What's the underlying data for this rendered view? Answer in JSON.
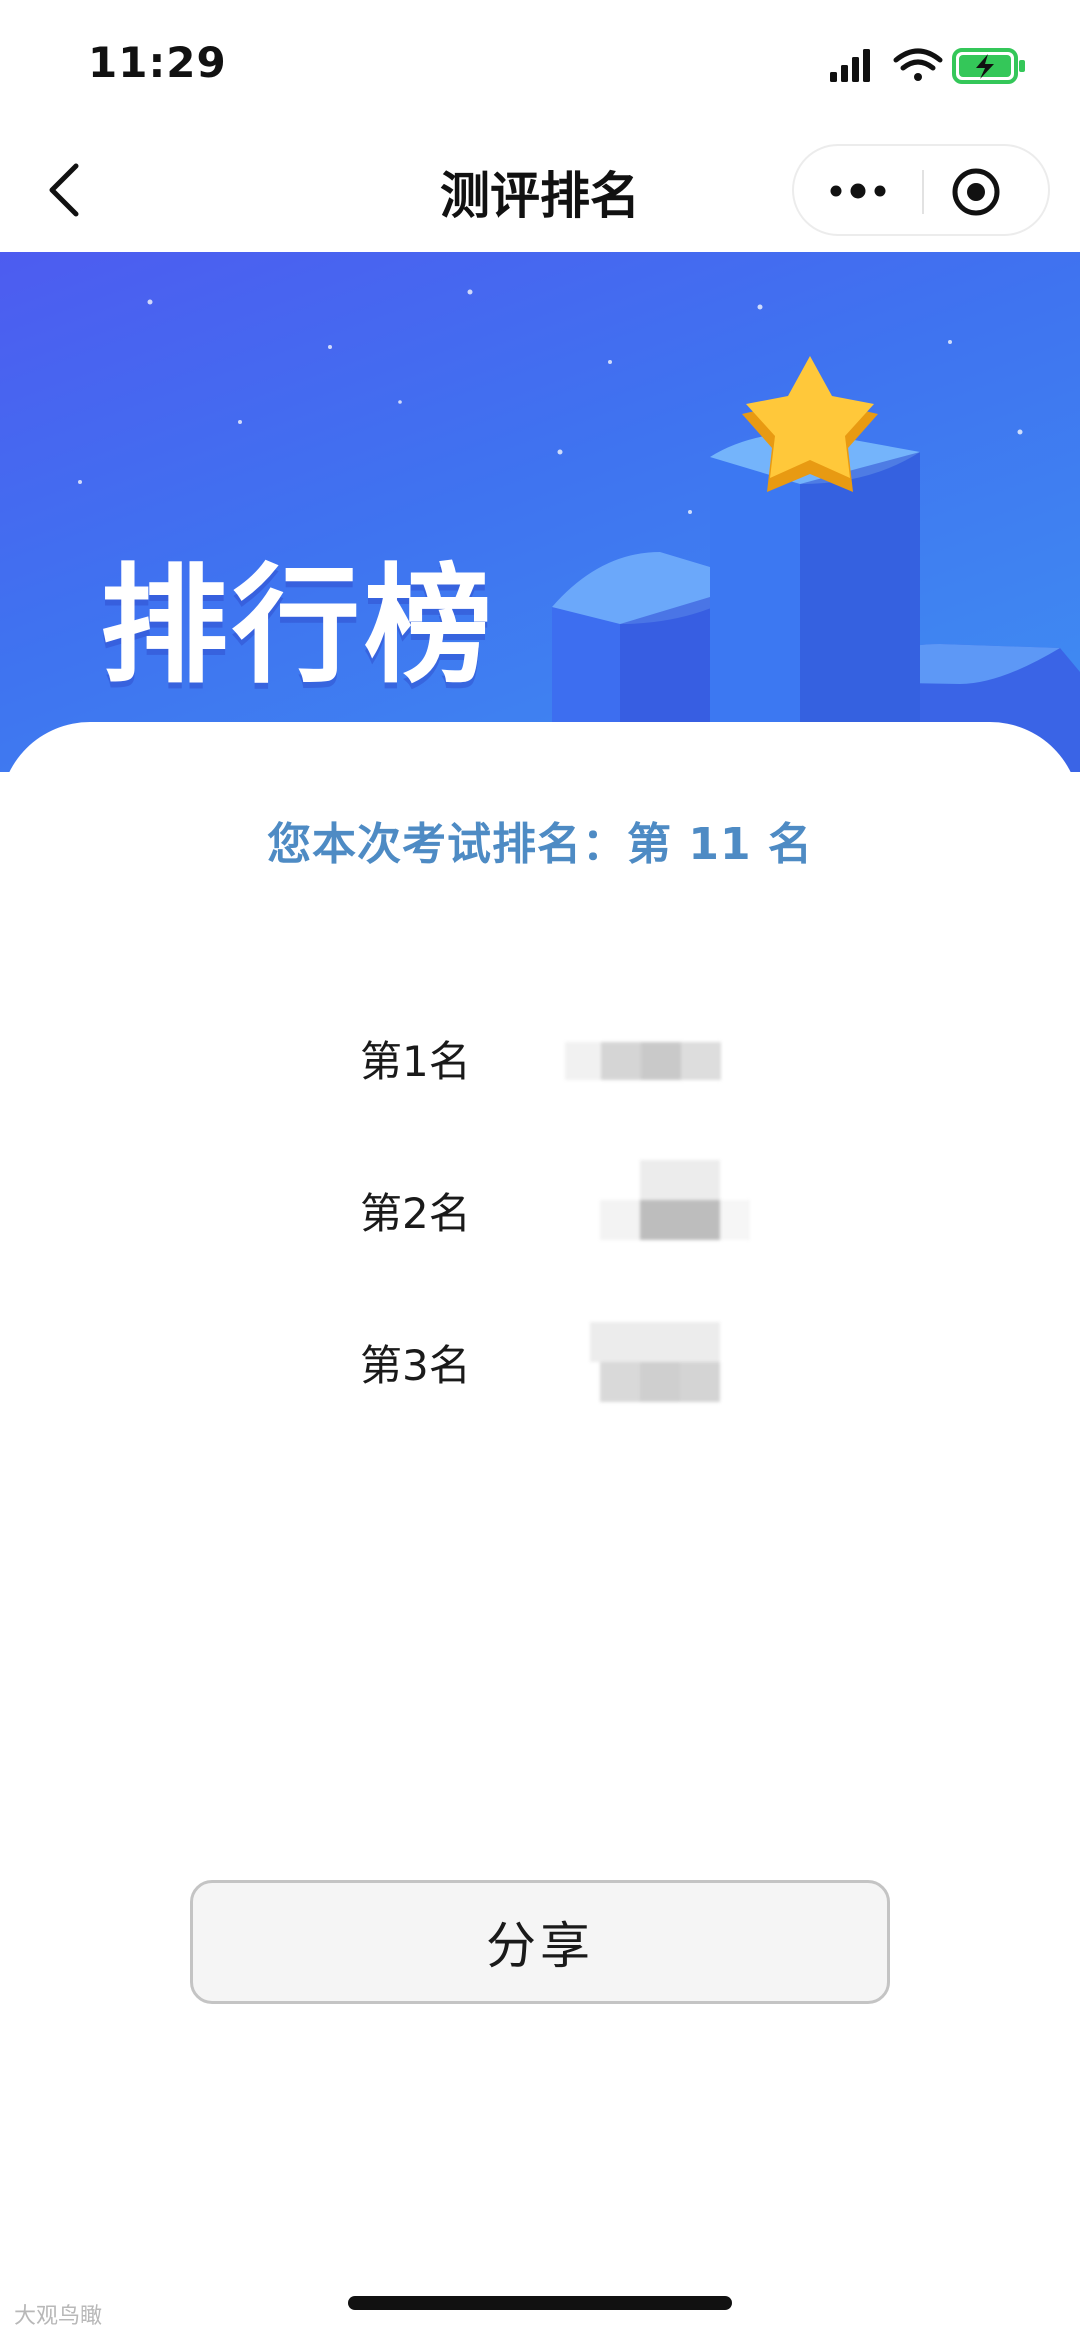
{
  "status_bar": {
    "time": "11:29",
    "icons": [
      "signal-icon",
      "wifi-icon",
      "battery-charging-icon"
    ],
    "battery_color": "#34c759"
  },
  "nav": {
    "title": "测评排名",
    "back_icon": "chevron-left-icon",
    "menu_icons": [
      "more-dots-icon",
      "close-target-icon"
    ]
  },
  "banner": {
    "title": "排行榜",
    "colors": {
      "from": "#4d5cf0",
      "to": "#3f8ef2"
    },
    "decoration": [
      "star-icon",
      "podium-blocks"
    ]
  },
  "result": {
    "text": "您本次考试排名：第 11 名",
    "color": "#4e8bc4"
  },
  "ranking": [
    {
      "label": "第1名"
    },
    {
      "label": "第2名"
    },
    {
      "label": "第3名"
    }
  ],
  "share_button": {
    "label": "分享"
  },
  "watermark": "大观鸟瞰"
}
